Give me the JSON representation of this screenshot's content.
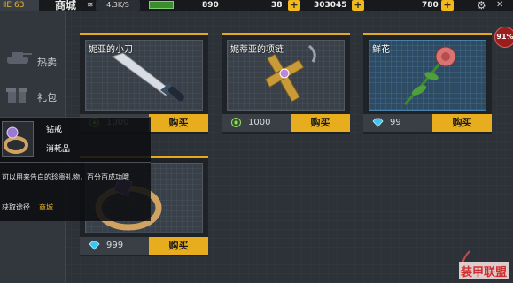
{
  "topbar": {
    "level": "ⅡE 63",
    "shop_title": "商城",
    "network_speed": "4.3K/S",
    "stamina": "890",
    "energy": "38",
    "gold": "303045",
    "diamonds": "780",
    "plus_label": "+",
    "gear_icon": "gear-icon",
    "close_label": "✕"
  },
  "sidebar": {
    "tabs": [
      {
        "label": "热卖",
        "icon": "tank-icon"
      },
      {
        "label": "礼包",
        "icon": "gift-icon"
      }
    ]
  },
  "progress_badge": "91%",
  "items": [
    {
      "name": "妮亚的小刀",
      "price": "1000",
      "currency": "gold-coin",
      "buy_label": "购买",
      "art": "knife"
    },
    {
      "name": "妮蒂亚的项链",
      "price": "1000",
      "currency": "gold-coin",
      "buy_label": "购买",
      "art": "cross-necklace"
    },
    {
      "name": "鲜花",
      "price": "99",
      "currency": "diamond",
      "buy_label": "购买",
      "art": "rose"
    },
    {
      "name": "",
      "price": "999",
      "currency": "diamond",
      "buy_label": "购买",
      "art": "ring"
    }
  ],
  "tooltip": {
    "item_name": "钻戒",
    "category": "消耗品",
    "description": "可以用来告白的珍贵礼物，百分百成功哦",
    "source_label": "获取途径",
    "source_value": "商城"
  },
  "logo_text": "装甲联盟",
  "colors": {
    "accent": "#e8ad1f",
    "card_bg": "#1f2328",
    "flower_bg": "#2d4b63"
  }
}
